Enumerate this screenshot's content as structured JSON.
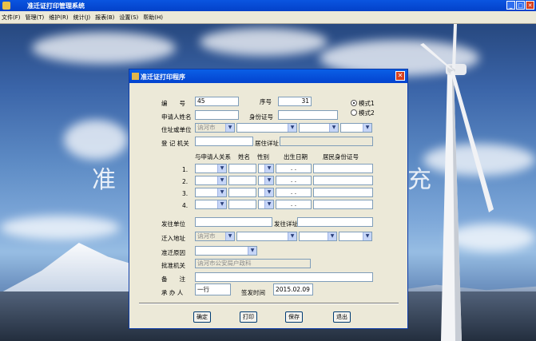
{
  "window": {
    "title": "准迁证打印管理系统"
  },
  "menu": [
    "文件(F)",
    "管理(T)",
    "维护(R)",
    "统计(J)",
    "报表(B)",
    "设置(S)",
    "帮助(H)"
  ],
  "background": {
    "left_char": "准",
    "right_char": "充"
  },
  "dialog": {
    "title": "准迁证打印程序",
    "labels": {
      "number": "编　　号",
      "seq": "序号",
      "applicant": "申请人姓名",
      "idno": "身份证号",
      "address_unit": "住址或单位",
      "register_office": "登 记 机关",
      "office_addr": "居住详址",
      "relation": "与申请人关系",
      "name": "姓名",
      "gender": "性别",
      "birth": "出生日期",
      "citizen_id": "居民身份证号",
      "issue_unit": "发往单位",
      "issue_addr": "发往详址",
      "move_in": "迁入地址",
      "reason": "准迁原因",
      "approver": "批准机关",
      "remark": "备　　注",
      "handler": "承 办 人",
      "issue_time": "签发时间"
    },
    "values": {
      "number": "45",
      "seq": "31",
      "city": "讷河市",
      "approver": "讷河市公安局户政科",
      "handler": "一行",
      "issue_time": "2015.02.09",
      "date_placeholder": ".   ."
    },
    "modes": [
      "模式1",
      "模式2"
    ],
    "rows": [
      "1.",
      "2.",
      "3.",
      "4."
    ],
    "buttons": [
      "确定",
      "打印",
      "保存",
      "退出"
    ]
  }
}
